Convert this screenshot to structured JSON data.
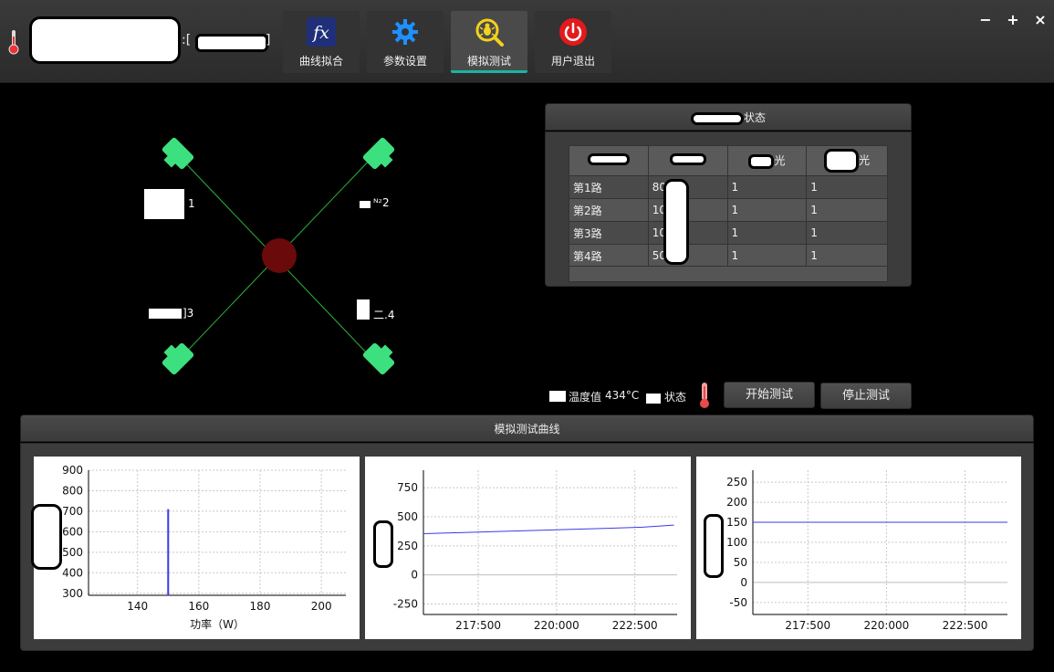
{
  "header": {
    "subtitle_prefix": ":[",
    "subtitle_suffix": "]",
    "nav": [
      {
        "label": "曲线拟合",
        "icon": "fx-icon"
      },
      {
        "label": "参数设置",
        "icon": "gear-icon"
      },
      {
        "label": "模拟测试",
        "icon": "bug-search-icon",
        "active": true
      },
      {
        "label": "用户退出",
        "icon": "power-icon"
      }
    ],
    "window_controls": {
      "minimize": "−",
      "maximize": "+",
      "close": "×"
    }
  },
  "diagram": {
    "labels": [
      "1",
      "2",
      "3",
      "4"
    ],
    "label_partial": [
      "1",
      "ᴺᶻ2",
      "]3",
      "二.4"
    ]
  },
  "status_panel": {
    "title_suffix": "状态",
    "headers": [
      "",
      "",
      "光",
      "光"
    ],
    "rows": [
      [
        "第1路",
        "80",
        "1",
        "1"
      ],
      [
        "第2路",
        "10",
        "1",
        "1"
      ],
      [
        "第3路",
        "10",
        "1",
        "1"
      ],
      [
        "第4路",
        "50",
        "1",
        "1"
      ]
    ]
  },
  "controls": {
    "temp_label": "温度值",
    "temp_value": "434°C",
    "state_label": "状态",
    "start_button": "开始测试",
    "stop_button": "停止测试"
  },
  "curves": {
    "title": "模拟测试曲线"
  },
  "chart_data": [
    {
      "type": "line",
      "title": "",
      "xlabel": "功率（W）",
      "ylabel": "",
      "xlim": [
        124,
        208
      ],
      "ylim": [
        290,
        900
      ],
      "xticks": [
        140,
        160,
        180,
        200
      ],
      "yticks": [
        300,
        400,
        500,
        600,
        700,
        800,
        900
      ],
      "series": [
        {
          "x": [
            150,
            150
          ],
          "y": [
            290,
            710
          ]
        }
      ],
      "grid": true
    },
    {
      "type": "line",
      "title": "",
      "xlabel": "",
      "ylabel": "",
      "xlim": [
        217000,
        225100
      ],
      "ylim": [
        -340,
        900
      ],
      "xticks": [
        "217:500",
        "220:000",
        "222:500"
      ],
      "yticks": [
        -250,
        0,
        250,
        500,
        750
      ],
      "series": [
        {
          "x": [
            217000,
            218000,
            219000,
            220000,
            221000,
            222000,
            223000,
            224000,
            225000
          ],
          "y": [
            355,
            362,
            370,
            378,
            386,
            394,
            402,
            410,
            428
          ]
        }
      ],
      "grid": true
    },
    {
      "type": "line",
      "title": "",
      "xlabel": "",
      "ylabel": "",
      "xlim": [
        217000,
        225100
      ],
      "ylim": [
        -80,
        280
      ],
      "xticks": [
        "217:500",
        "220:000",
        "222:500"
      ],
      "yticks": [
        -50,
        0,
        50,
        100,
        150,
        200,
        250
      ],
      "series": [
        {
          "x": [
            217000,
            225100
          ],
          "y": [
            150,
            150
          ]
        }
      ],
      "grid": true
    }
  ]
}
